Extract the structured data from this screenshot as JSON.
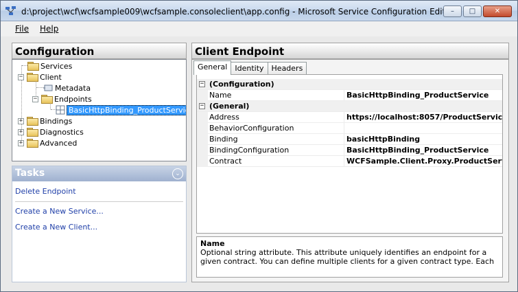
{
  "window": {
    "title": "d:\\project\\wcf\\wcfsample009\\wcfsample.consoleclient\\app.config - Microsoft Service Configuration Editor",
    "minimize_glyph": "–",
    "maximize_glyph": "□",
    "close_glyph": "✕"
  },
  "menu": {
    "file": "File",
    "help": "Help"
  },
  "left_panel": {
    "title": "Configuration",
    "tree": [
      {
        "label": "Services",
        "expander": ""
      },
      {
        "label": "Client",
        "expander": "−"
      },
      {
        "label": "Metadata",
        "expander": ""
      },
      {
        "label": "Endpoints",
        "expander": "−"
      },
      {
        "label": "BasicHttpBinding_ProductService",
        "expander": ""
      },
      {
        "label": "Bindings",
        "expander": "+"
      },
      {
        "label": "Diagnostics",
        "expander": "+"
      },
      {
        "label": "Advanced",
        "expander": "+"
      }
    ]
  },
  "tasks": {
    "title": "Tasks",
    "collapse_glyph": "⌄",
    "items": [
      "Delete Endpoint",
      "Create a New Service...",
      "Create a New Client..."
    ]
  },
  "right_panel": {
    "title": "Client Endpoint",
    "tabs": [
      "General",
      "Identity",
      "Headers"
    ],
    "active_tab": "General"
  },
  "property_grid": {
    "rows": [
      {
        "type": "cat",
        "toggle": "−",
        "key": "(Configuration)",
        "value": ""
      },
      {
        "type": "prop",
        "key": "Name",
        "value": "BasicHttpBinding_ProductService"
      },
      {
        "type": "cat",
        "toggle": "−",
        "key": "(General)",
        "value": ""
      },
      {
        "type": "prop",
        "key": "Address",
        "value": "https://localhost:8057/ProductService"
      },
      {
        "type": "prop",
        "key": "BehaviorConfiguration",
        "value": ""
      },
      {
        "type": "prop",
        "key": "Binding",
        "value": "basicHttpBinding"
      },
      {
        "type": "prop",
        "key": "BindingConfiguration",
        "value": "BasicHttpBinding_ProductService"
      },
      {
        "type": "prop",
        "key": "Contract",
        "value": "WCFSample.Client.Proxy.ProductService"
      }
    ]
  },
  "description": {
    "title": "Name",
    "text": "Optional string attribute. This attribute uniquely identifies an endpoint for a given contract. You can define multiple clients for a given contract type. Each definition mus..."
  }
}
